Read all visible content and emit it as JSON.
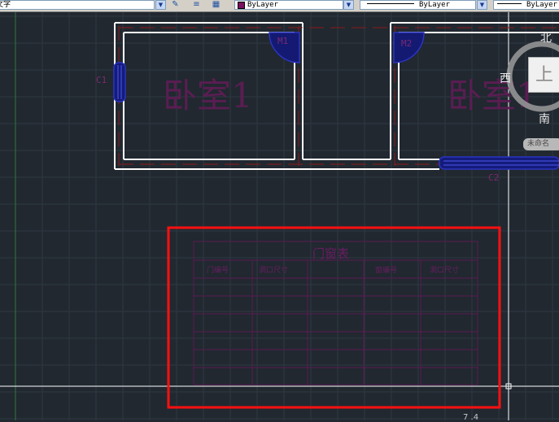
{
  "toolbar": {
    "text_style": "文字",
    "color": "ByLayer",
    "linetype": "ByLayer",
    "lineweight": "ByLayer"
  },
  "drawing": {
    "rooms": [
      "卧室1",
      "卧室1"
    ],
    "door_tags": [
      "M1",
      "M2",
      "C1",
      "C2"
    ],
    "table_title": "门窗表",
    "table_headers": [
      "门编号",
      "洞口尺寸",
      "窗编号",
      "洞口尺寸"
    ]
  },
  "viewcube": {
    "north": "北",
    "south": "南",
    "west": "西",
    "top": "上",
    "wcs": "未命名"
  },
  "status": {
    "coord": "7 .4"
  },
  "colors": {
    "background": "#212830",
    "grid": "#2f3742",
    "wall": "#ffffff",
    "annotation": "#6a1d62",
    "door": "#1e2a9a",
    "selection": "#ff1010"
  }
}
